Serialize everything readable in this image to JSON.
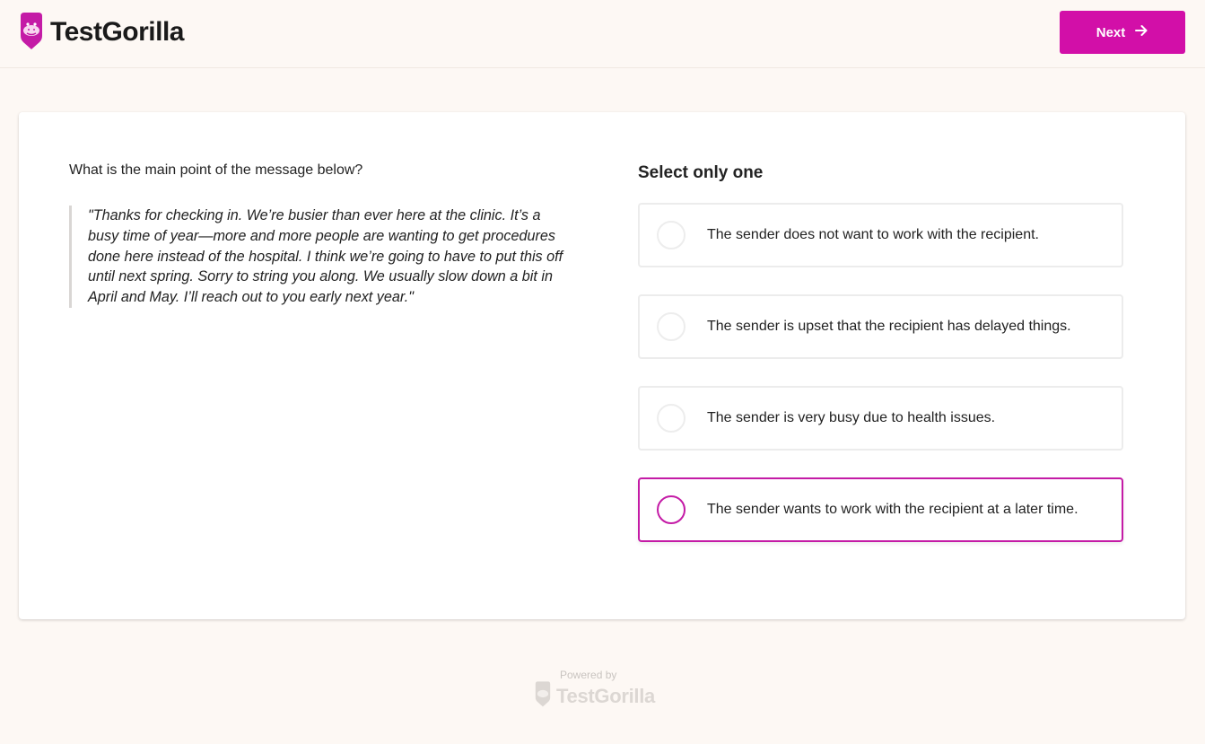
{
  "brand": {
    "name": "TestGorilla",
    "accent_color": "#d20fa8"
  },
  "header": {
    "next_label": "Next",
    "next_icon": "arrow-right-icon"
  },
  "question": {
    "prompt": "What is the main point of the message below?",
    "quote": "\"Thanks for checking in. We’re busier than ever here at the clinic. It’s a busy time of year—more and more people are wanting to get procedures done here instead of the hospital. I think we’re going to have to put this off until next spring. Sorry to string you along. We usually slow down a bit in April and May. I’ll reach out to you early next year.\""
  },
  "answers": {
    "instruction": "Select only one",
    "options": [
      {
        "label": "The sender does not want to work with the recipient.",
        "selected": false
      },
      {
        "label": "The sender is upset that the recipient has delayed things.",
        "selected": false
      },
      {
        "label": "The sender is very busy due to health issues.",
        "selected": false
      },
      {
        "label": "The sender wants to work with the recipient at a later time.",
        "selected": true
      }
    ]
  },
  "footer": {
    "powered_by": "Powered by",
    "brand": "TestGorilla"
  }
}
